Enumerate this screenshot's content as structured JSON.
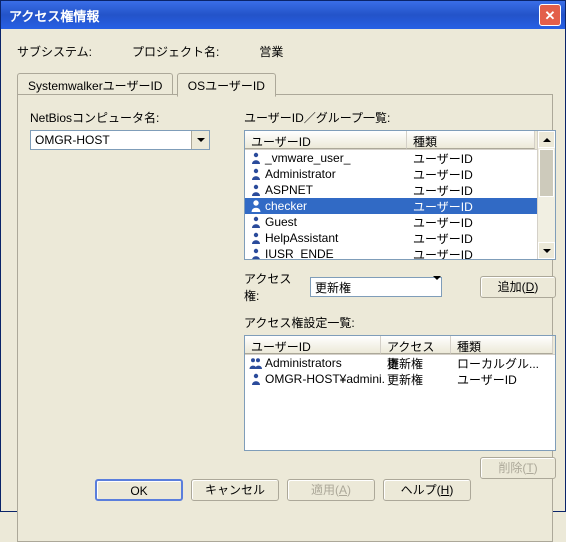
{
  "title": "アクセス権情報",
  "subsystem_label": "サブシステム:",
  "project_label": "プロジェクト名:",
  "project_value": "営業",
  "tabs": {
    "systemwalker": "SystemwalkerユーザーID",
    "os": "OSユーザーID"
  },
  "netbios_label": "NetBiosコンピュータ名:",
  "netbios_value": "OMGR-HOST",
  "users_label": "ユーザーID／グループ一覧:",
  "user_list_cols": {
    "id": "ユーザーID",
    "type": "種類"
  },
  "user_list": [
    {
      "id": "_vmware_user_",
      "type": "ユーザーID",
      "icon": "person"
    },
    {
      "id": "Administrator",
      "type": "ユーザーID",
      "icon": "person"
    },
    {
      "id": "ASPNET",
      "type": "ユーザーID",
      "icon": "person"
    },
    {
      "id": "checker",
      "type": "ユーザーID",
      "icon": "person",
      "selected": true
    },
    {
      "id": "Guest",
      "type": "ユーザーID",
      "icon": "person"
    },
    {
      "id": "HelpAssistant",
      "type": "ユーザーID",
      "icon": "person"
    },
    {
      "id": "IUSR_ENDE",
      "type": "ユーザーID",
      "icon": "person"
    }
  ],
  "access_label": "アクセス権:",
  "access_value": "更新権",
  "add_button": "追加(D)",
  "settings_label": "アクセス権設定一覧:",
  "settings_cols": {
    "id": "ユーザーID",
    "access": "アクセス権",
    "type": "種類"
  },
  "settings_list": [
    {
      "id": "Administrators",
      "access": "更新権",
      "type": "ローカルグル...",
      "icon": "group"
    },
    {
      "id": "OMGR-HOST¥admini...",
      "access": "更新権",
      "type": "ユーザーID",
      "icon": "person"
    }
  ],
  "delete_button": "削除(T)",
  "buttons": {
    "ok": "OK",
    "cancel": "キャンセル",
    "apply": "適用(A)",
    "help": "ヘルプ(H)"
  }
}
